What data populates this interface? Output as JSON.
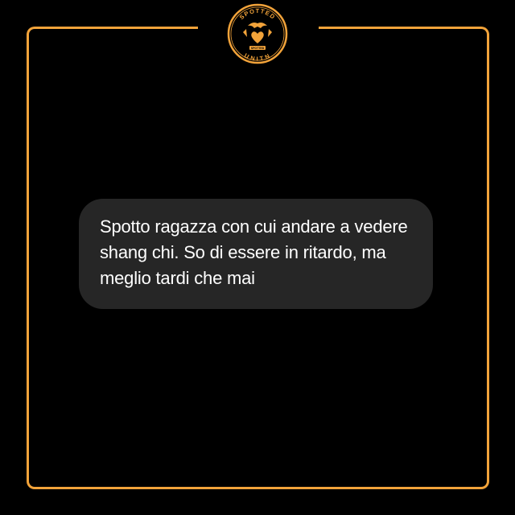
{
  "logo": {
    "top_text": "SPOTTED",
    "bottom_text": "UNITN",
    "ribbon_text": "SPOTTED",
    "icon": "eagle-heart-emblem"
  },
  "message": {
    "text": "Spotto ragazza con cui andare a vedere shang chi. So di essere in ritardo, ma meglio tardi che mai"
  },
  "colors": {
    "accent": "#f2a33a",
    "background": "#000000",
    "bubble": "#262626",
    "text": "#ffffff"
  }
}
